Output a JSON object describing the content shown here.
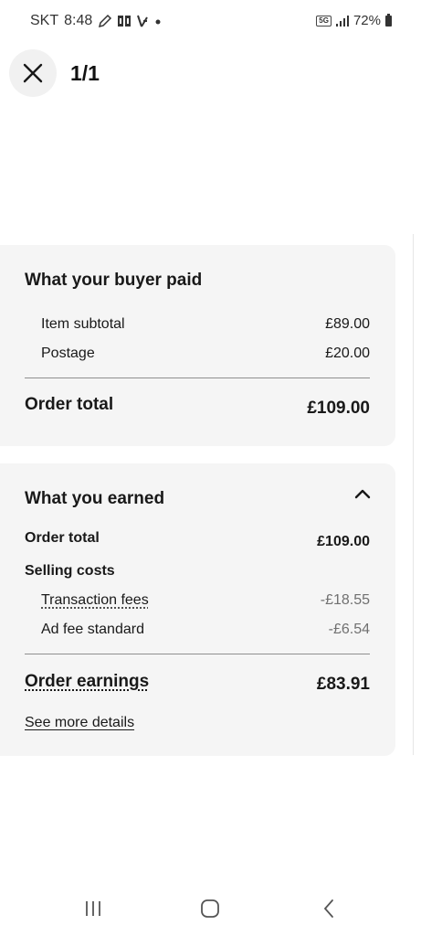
{
  "status_bar": {
    "carrier": "SKT",
    "time": "8:48",
    "network": "5G",
    "battery": "72%",
    "icons": [
      "edit-icon",
      "cast-icon",
      "music-icon",
      "dot-icon",
      "signal-icon",
      "battery-icon"
    ]
  },
  "header": {
    "close_icon": "close-icon",
    "page_indicator": "1/1"
  },
  "buyer_paid": {
    "title": "What your buyer paid",
    "rows": [
      {
        "label": "Item subtotal",
        "value": "£89.00"
      },
      {
        "label": "Postage",
        "value": "£20.00"
      }
    ],
    "total": {
      "label": "Order total",
      "value": "£109.00"
    }
  },
  "earned": {
    "title": "What you earned",
    "toggle_icon": "chevron-up-icon",
    "order_total": {
      "label": "Order total",
      "value": "£109.00"
    },
    "selling_costs_label": "Selling costs",
    "fees": [
      {
        "label": "Transaction fees",
        "value": "-£18.55"
      },
      {
        "label": "Ad fee standard",
        "value": "-£6.54"
      }
    ],
    "earnings": {
      "label": "Order earnings",
      "value": "£83.91"
    },
    "details_link": "See more details"
  },
  "nav_bar": {
    "icons": [
      "recent-apps-icon",
      "home-icon",
      "back-icon"
    ]
  }
}
